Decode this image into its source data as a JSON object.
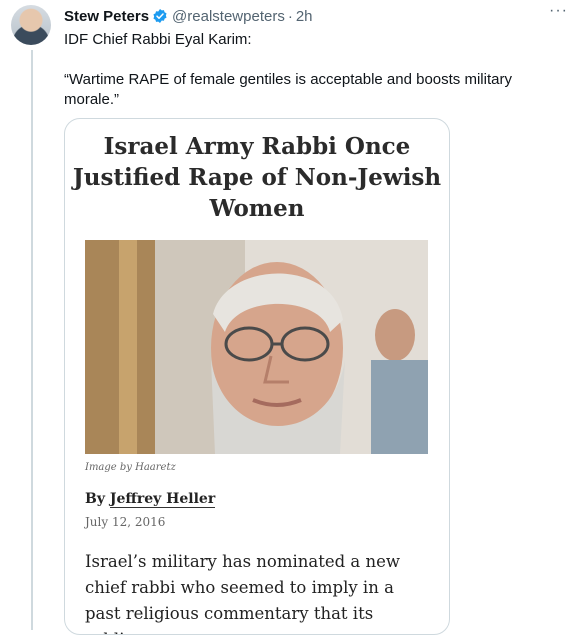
{
  "author": {
    "name": "Stew Peters",
    "handle": "@realstewpeters",
    "separator": "·",
    "time": "2h"
  },
  "tweet": {
    "text": "IDF Chief Rabbi Eyal Karim:\n\n“Wartime RAPE of female gentiles is acceptable and boosts military morale.”"
  },
  "menu": {
    "more_label": "···"
  },
  "card": {
    "headline": "Israel Army Rabbi Once Justified Rape of Non-Jewish Women",
    "image_caption": "Image by Haaretz",
    "byline_prefix": "By",
    "byline_author": "Jeffrey Heller",
    "date": "July 12, 2016",
    "body": "Israel’s military has nominated a new chief rabbi who seemed to imply in a past religious commentary that its soldiers are"
  },
  "colors": {
    "accent": "#1d9bf0",
    "secondary_text": "#536471",
    "border": "#cfd9de"
  },
  "icons": {
    "verified": "verified-badge-icon",
    "more": "more-icon"
  }
}
